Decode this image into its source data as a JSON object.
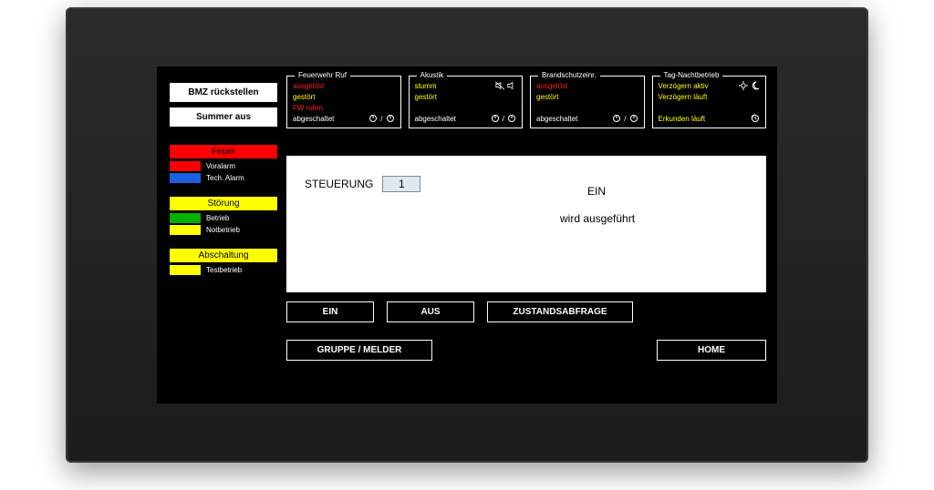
{
  "left": {
    "btn_reset": "BMZ rückstellen",
    "btn_buzzer": "Summer aus",
    "groups": {
      "fire": {
        "header": "Feuer",
        "items": [
          "Voralarm",
          "Tech. Alarm"
        ]
      },
      "fault": {
        "header": "Störung",
        "items": [
          "Betrieb",
          "Notbetrieb"
        ]
      },
      "disable": {
        "header": "Abschaltung",
        "items": [
          "Testbetrieb"
        ]
      }
    }
  },
  "top": {
    "fw": {
      "title": "Feuerwehr Ruf",
      "l1": "ausgelöst",
      "l2": "gestört",
      "l3": "FW rufen",
      "l4": "abgeschaltet"
    },
    "ak": {
      "title": "Akustik",
      "l1": "stumm",
      "l2": "gestört",
      "l4": "abgeschaltet"
    },
    "bs": {
      "title": "Brandschutzeinr.",
      "l1": "ausgelöst",
      "l2": "gestört",
      "l4": "abgeschaltet"
    },
    "tn": {
      "title": "Tag-Nachtbetrieb",
      "l1": "Verzögern aktiv",
      "l2": "Verzögern läuft",
      "l4": "Erkunden läuft"
    }
  },
  "display": {
    "label": "STEUERUNG",
    "value": "1",
    "state": "EIN",
    "msg": "wird ausgeführt"
  },
  "actions": {
    "ein": "EIN",
    "aus": "AUS",
    "zustand": "ZUSTANDSABFRAGE",
    "gruppe": "GRUPPE / MELDER",
    "home": "HOME"
  }
}
